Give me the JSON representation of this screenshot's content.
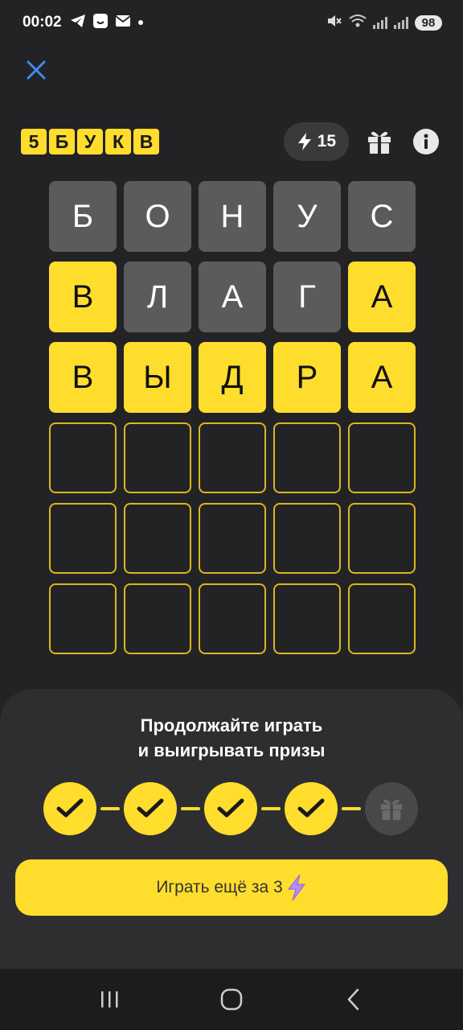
{
  "status_bar": {
    "time": "00:02",
    "battery": "98",
    "left_icons": [
      "telegram-icon",
      "app-face-icon",
      "mail-icon",
      "dot-icon"
    ],
    "right_icons": [
      "mute-icon",
      "wifi-icon",
      "signal-icon",
      "signal-icon"
    ]
  },
  "header": {
    "logo_letters": [
      "5",
      "Б",
      "У",
      "К",
      "В"
    ],
    "energy_count": "15",
    "icons": [
      "lightning-icon",
      "gift-icon",
      "info-icon"
    ]
  },
  "board": {
    "rows": [
      [
        {
          "l": "Б",
          "s": "gray"
        },
        {
          "l": "О",
          "s": "gray"
        },
        {
          "l": "Н",
          "s": "gray"
        },
        {
          "l": "У",
          "s": "gray"
        },
        {
          "l": "С",
          "s": "gray"
        }
      ],
      [
        {
          "l": "В",
          "s": "yellow"
        },
        {
          "l": "Л",
          "s": "gray"
        },
        {
          "l": "А",
          "s": "gray"
        },
        {
          "l": "Г",
          "s": "gray"
        },
        {
          "l": "А",
          "s": "yellow"
        }
      ],
      [
        {
          "l": "В",
          "s": "yellow"
        },
        {
          "l": "Ы",
          "s": "yellow"
        },
        {
          "l": "Д",
          "s": "yellow"
        },
        {
          "l": "Р",
          "s": "yellow"
        },
        {
          "l": "А",
          "s": "yellow"
        }
      ],
      [
        {
          "l": "",
          "s": "empty"
        },
        {
          "l": "",
          "s": "empty"
        },
        {
          "l": "",
          "s": "empty"
        },
        {
          "l": "",
          "s": "empty"
        },
        {
          "l": "",
          "s": "empty"
        }
      ],
      [
        {
          "l": "",
          "s": "empty"
        },
        {
          "l": "",
          "s": "empty"
        },
        {
          "l": "",
          "s": "empty"
        },
        {
          "l": "",
          "s": "empty"
        },
        {
          "l": "",
          "s": "empty"
        }
      ],
      [
        {
          "l": "",
          "s": "empty"
        },
        {
          "l": "",
          "s": "empty"
        },
        {
          "l": "",
          "s": "empty"
        },
        {
          "l": "",
          "s": "empty"
        },
        {
          "l": "",
          "s": "empty"
        }
      ]
    ]
  },
  "sheet": {
    "title_line1": "Продолжайте играть",
    "title_line2": "и выигрывать призы",
    "progress_completed": 4,
    "progress_total": 5,
    "play_button_label": "Играть ещё за 3"
  },
  "colors": {
    "accent": "#ffdd2d",
    "background": "#232325",
    "tile_gray": "#5b5b5d",
    "sheet": "#2e2e30",
    "close_icon": "#3d8bef"
  },
  "nav": [
    "recent-apps-icon",
    "home-icon",
    "back-icon"
  ]
}
